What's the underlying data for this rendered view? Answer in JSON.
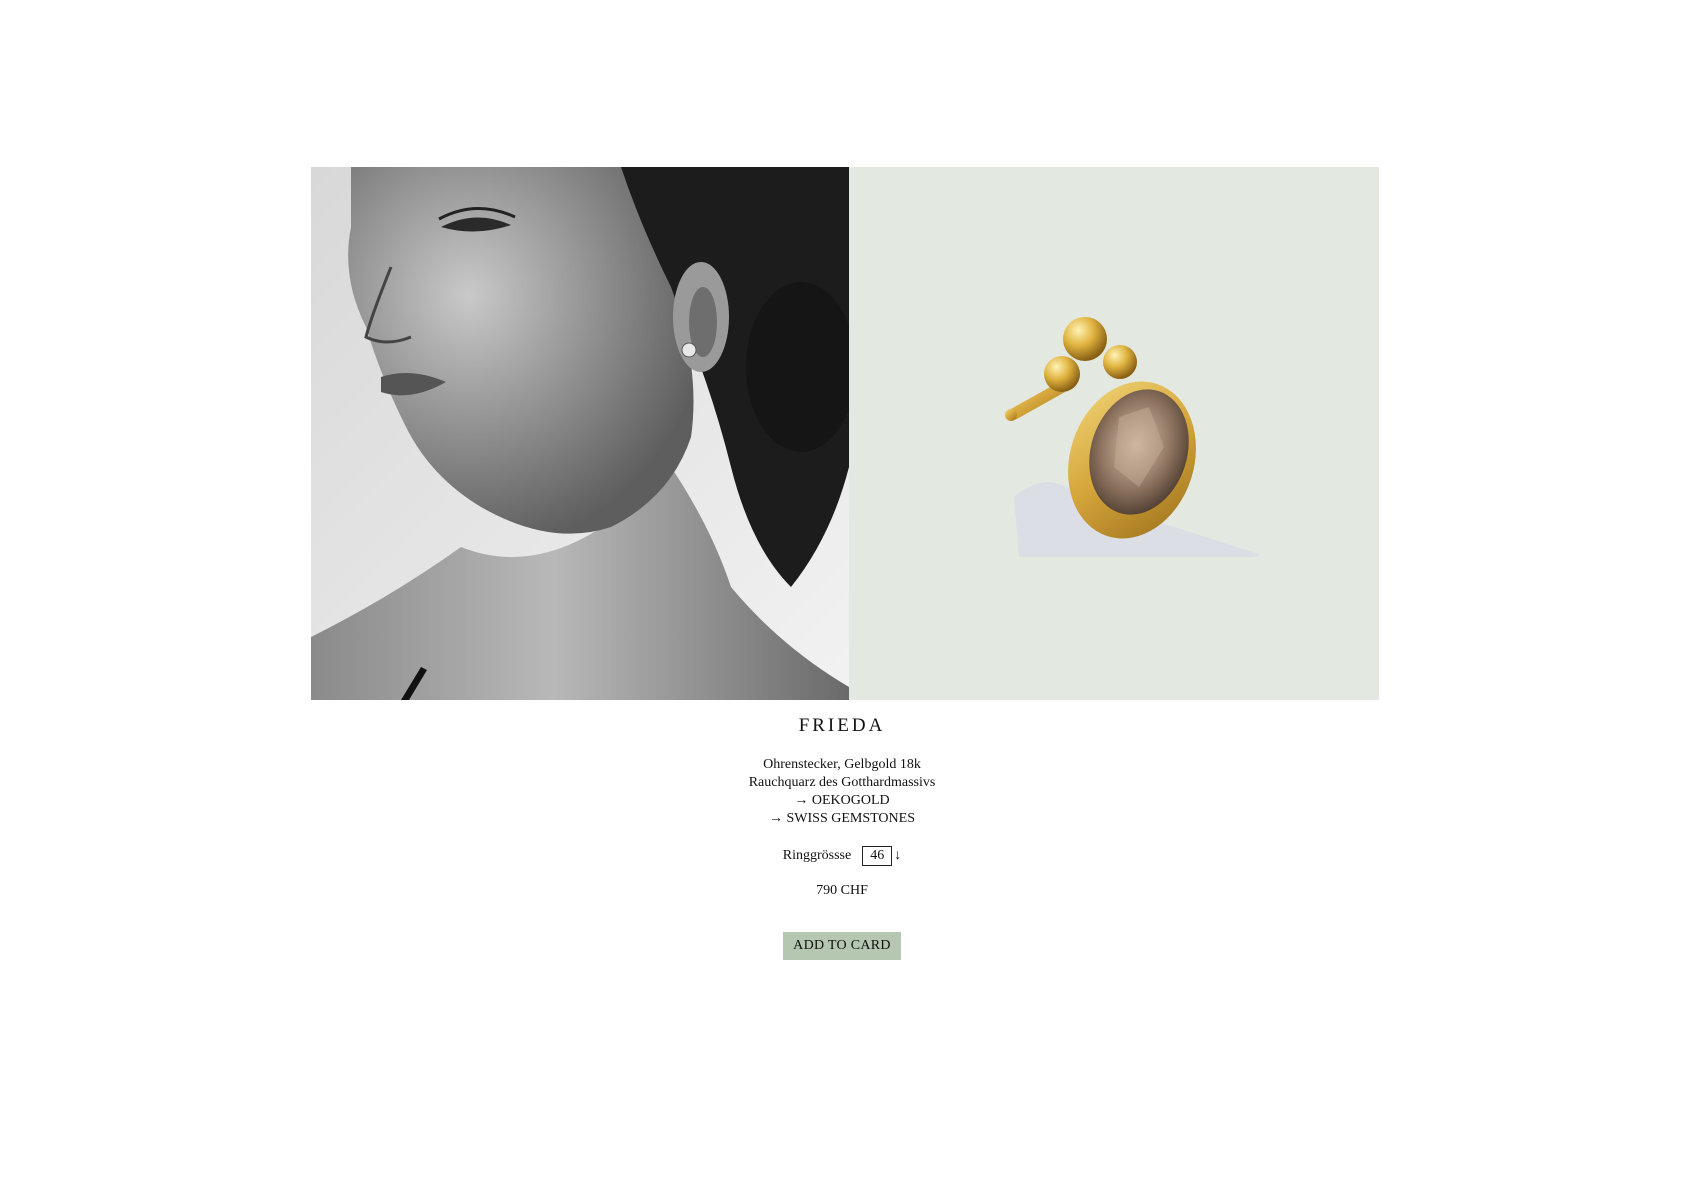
{
  "product": {
    "name": "FRIEDA",
    "description_lines": [
      "Ohrenstecker, Gelbgold 18k",
      "Rauchquarz des Gotthardmassivs"
    ],
    "links": [
      "→ OEKOGOLD",
      "→ SWISS GEMSTONES"
    ],
    "size_label": "Ringgrössse",
    "size_value": "46",
    "size_arrow": "↓",
    "price": "790 CHF",
    "add_button_label": "ADD TO CARD"
  },
  "images": {
    "model_photo": "portrait of model wearing earring (black and white)",
    "product_photo": "gold stud earring with smoky quartz"
  },
  "colors": {
    "product_background": "#e3e9e0",
    "button_background": "#b5c6b1",
    "text": "#111111"
  }
}
